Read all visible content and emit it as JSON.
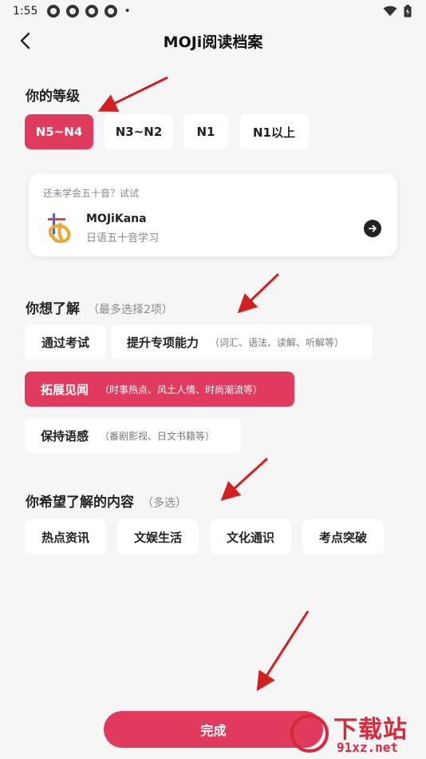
{
  "status_bar": {
    "time": "1:55",
    "dot": "•"
  },
  "header": {
    "title": "MOJi阅读档案"
  },
  "level": {
    "title": "你的等级",
    "options": [
      {
        "label": "N5~N4",
        "selected": true
      },
      {
        "label": "N3~N2",
        "selected": false
      },
      {
        "label": "N1",
        "selected": false
      },
      {
        "label": "N1以上",
        "selected": false
      }
    ]
  },
  "kana_card": {
    "prompt": "还未学会五十音？试试",
    "app_name": "MOJiKana",
    "app_desc": "日语五十音学习"
  },
  "goals": {
    "title": "你想了解",
    "hint": "（最多选择2项）",
    "options": [
      {
        "label": "通过考试",
        "sub": "",
        "selected": false
      },
      {
        "label": "提升专项能力",
        "sub": "（词汇、语法、读解、听解等）",
        "selected": false
      },
      {
        "label": "拓展见闻",
        "sub": "（时事热点、风土人情、时尚潮流等）",
        "selected": true
      },
      {
        "label": "保持语感",
        "sub": "（番剧影视、日文书籍等）",
        "selected": false
      }
    ]
  },
  "content": {
    "title": "你希望了解的内容",
    "hint": "（多选）",
    "options": [
      {
        "label": "热点资讯",
        "selected": false
      },
      {
        "label": "文娱生活",
        "selected": false
      },
      {
        "label": "文化通识",
        "selected": false
      },
      {
        "label": "考点突破",
        "selected": false
      }
    ]
  },
  "done_button": {
    "label": "完成"
  },
  "watermark": {
    "text": "下载站",
    "url": "91xz.net"
  },
  "colors": {
    "accent": "#e03a5c",
    "background": "#f6f6f6",
    "annotation_arrow": "#d21f1f"
  }
}
